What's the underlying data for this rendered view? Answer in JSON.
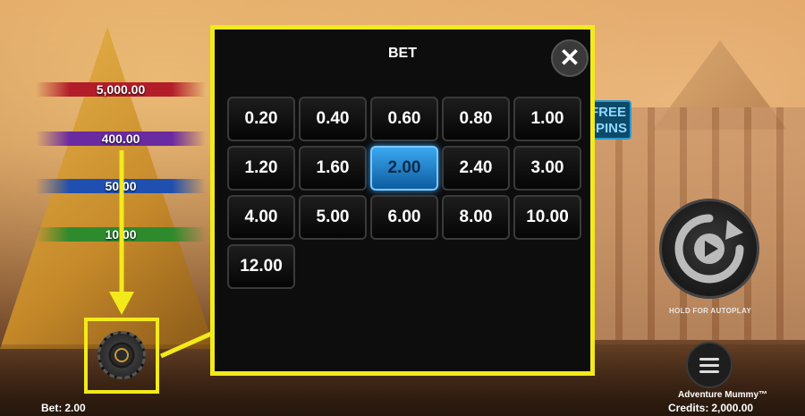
{
  "background": {
    "prize_levels": [
      "5,000.00",
      "400.00",
      "50.00",
      "10.00"
    ],
    "free_spins_badge": "FREE SPINS"
  },
  "bet_panel": {
    "title": "BET",
    "close_icon": "close-icon",
    "options": [
      "0.20",
      "0.40",
      "0.60",
      "0.80",
      "1.00",
      "1.20",
      "1.60",
      "2.00",
      "2.40",
      "3.00",
      "4.00",
      "5.00",
      "6.00",
      "8.00",
      "10.00",
      "12.00"
    ],
    "selected": "2.00",
    "selected_color": "#1e7fd0",
    "highlight_color": "#f2ea1a"
  },
  "controls": {
    "spin_icon": "spin-autoplay-icon",
    "autoplay_label": "HOLD FOR AUTOPLAY",
    "menu_icon": "hamburger-menu-icon",
    "bet_chip_icon": "bet-chip-icon"
  },
  "footer": {
    "game_title": "Adventure Mummy™",
    "credits_label": "Credits:",
    "credits_value": "2,000.00",
    "bet_label": "Bet:",
    "bet_value": "2.00"
  }
}
